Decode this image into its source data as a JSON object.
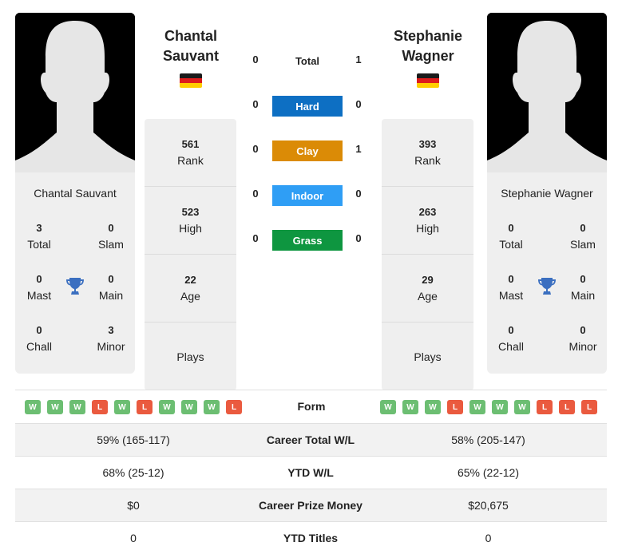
{
  "colors": {
    "hard": "#0d6fc3",
    "clay": "#db8b06",
    "indoor": "#2f9ef5",
    "grass": "#0e9640",
    "win": "#6cbe72",
    "loss": "#ea5a3f",
    "trophy": "#3b6fc0",
    "card_bg": "#efefef"
  },
  "player1": {
    "name_line1": "Chantal",
    "name_line2": "Sauvant",
    "full_name": "Chantal Sauvant",
    "country_flag": "germany-flag",
    "titles": {
      "total": {
        "value": "3",
        "label": "Total"
      },
      "slam": {
        "value": "0",
        "label": "Slam"
      },
      "mast": {
        "value": "0",
        "label": "Mast"
      },
      "main": {
        "value": "0",
        "label": "Main"
      },
      "chall": {
        "value": "0",
        "label": "Chall"
      },
      "minor": {
        "value": "3",
        "label": "Minor"
      }
    },
    "rank": {
      "value": "561",
      "label": "Rank"
    },
    "high": {
      "value": "523",
      "label": "High"
    },
    "age": {
      "value": "22",
      "label": "Age"
    },
    "plays": {
      "value": "",
      "label": "Plays"
    },
    "form": [
      "W",
      "W",
      "W",
      "L",
      "W",
      "L",
      "W",
      "W",
      "W",
      "L"
    ]
  },
  "player2": {
    "name_line1": "Stephanie",
    "name_line2": "Wagner",
    "full_name": "Stephanie Wagner",
    "country_flag": "germany-flag",
    "titles": {
      "total": {
        "value": "0",
        "label": "Total"
      },
      "slam": {
        "value": "0",
        "label": "Slam"
      },
      "mast": {
        "value": "0",
        "label": "Mast"
      },
      "main": {
        "value": "0",
        "label": "Main"
      },
      "chall": {
        "value": "0",
        "label": "Chall"
      },
      "minor": {
        "value": "0",
        "label": "Minor"
      }
    },
    "rank": {
      "value": "393",
      "label": "Rank"
    },
    "high": {
      "value": "263",
      "label": "High"
    },
    "age": {
      "value": "29",
      "label": "Age"
    },
    "plays": {
      "value": "",
      "label": "Plays"
    },
    "form": [
      "W",
      "W",
      "W",
      "L",
      "W",
      "W",
      "W",
      "L",
      "L",
      "L"
    ]
  },
  "h2h": {
    "total": {
      "label": "Total",
      "p1": "0",
      "p2": "1"
    },
    "surfaces": [
      {
        "label": "Hard",
        "p1": "0",
        "p2": "0",
        "color_key": "hard"
      },
      {
        "label": "Clay",
        "p1": "0",
        "p2": "1",
        "color_key": "clay"
      },
      {
        "label": "Indoor",
        "p1": "0",
        "p2": "0",
        "color_key": "indoor"
      },
      {
        "label": "Grass",
        "p1": "0",
        "p2": "0",
        "color_key": "grass"
      }
    ]
  },
  "comparison": {
    "form_label": "Form",
    "rows": [
      {
        "label": "Career Total W/L",
        "p1": "59% (165-117)",
        "p2": "58% (205-147)"
      },
      {
        "label": "YTD W/L",
        "p1": "68% (25-12)",
        "p2": "65% (22-12)"
      },
      {
        "label": "Career Prize Money",
        "p1": "$0",
        "p2": "$20,675"
      },
      {
        "label": "YTD Titles",
        "p1": "0",
        "p2": "0"
      }
    ]
  }
}
